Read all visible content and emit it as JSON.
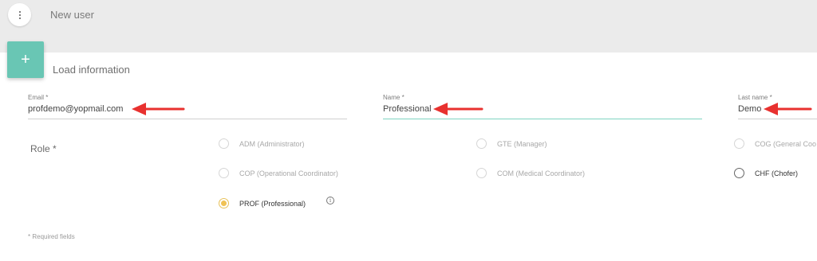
{
  "header": {
    "title": "New user",
    "menu_icon": "more-vert-icon"
  },
  "section": {
    "title": "Load information",
    "add_icon": "plus-icon"
  },
  "fields": {
    "email": {
      "label": "Email *",
      "value": "profdemo@yopmail.com"
    },
    "name": {
      "label": "Name *",
      "value": "Professional"
    },
    "last_name": {
      "label": "Last name *",
      "value": "Demo"
    }
  },
  "role": {
    "label": "Role *",
    "options": [
      {
        "label": "ADM (Administrator)",
        "selected": false,
        "enabled": false
      },
      {
        "label": "GTE (Manager)",
        "selected": false,
        "enabled": false
      },
      {
        "label": "COG (General Coo",
        "selected": false,
        "enabled": false
      },
      {
        "label": "COP (Operational Coordinator)",
        "selected": false,
        "enabled": false
      },
      {
        "label": "COM (Medical Coordinator)",
        "selected": false,
        "enabled": false
      },
      {
        "label": "CHF (Chofer)",
        "selected": false,
        "enabled": true
      },
      {
        "label": "PROF (Professional)",
        "selected": true,
        "enabled": true
      }
    ],
    "info_icon": "info-icon"
  },
  "footer": {
    "required_note": "* Required fields"
  },
  "colors": {
    "accent": "#69c6b4",
    "selected_radio": "#f0c255",
    "annotation_arrow": "#e8312f"
  }
}
